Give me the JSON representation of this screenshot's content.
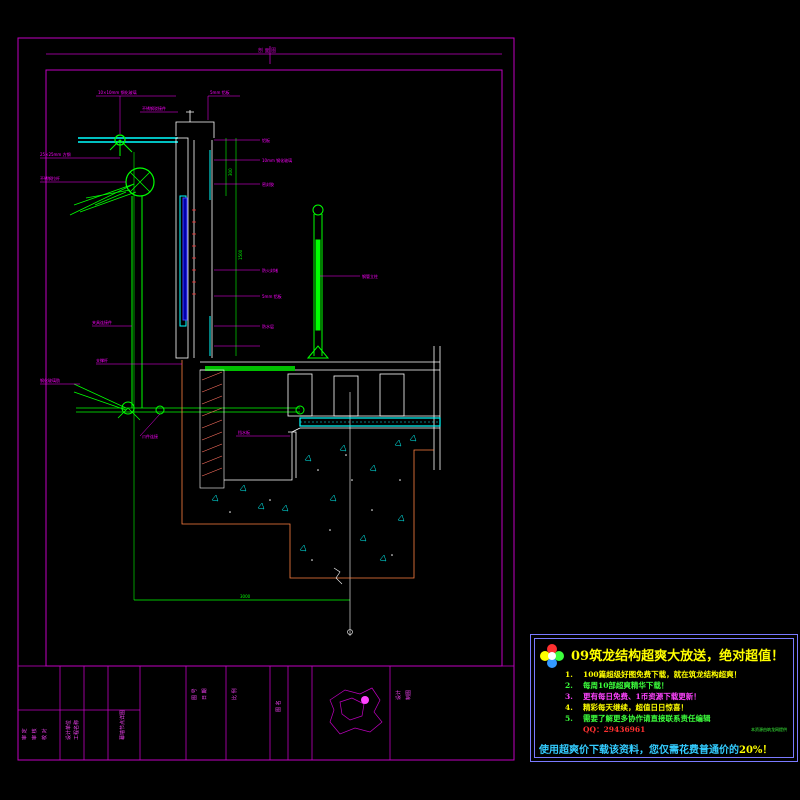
{
  "drawing": {
    "top_label": "剖 面 图",
    "dimension_bottom": "3000",
    "dimension_vertical_1": "300",
    "dimension_vertical_2": "1500",
    "labels_left": [
      "25×25mm 方钢",
      "不锈钢拉杆",
      "夹具连接件",
      "支撑杆",
      "钢化玻璃肋",
      "爪件连接"
    ],
    "labels_top": [
      "10×10mm 钢化玻璃",
      "不锈钢驳接件",
      "5mm 铝板"
    ],
    "labels_right": [
      "铝板",
      "10mm 钢化玻璃",
      "密封胶",
      "防火封堵",
      "5mm 铝板",
      "钢管立柱",
      "防水层",
      "挡水板"
    ],
    "colors": {
      "frame": "#c000c0",
      "steel": "#00e000",
      "glass": "#00ffff",
      "label": "#ff00ff",
      "concrete": "#ffffff",
      "hatch": "#ff7060"
    }
  },
  "title_block": {
    "col1": [
      "审 定",
      "审 核",
      "校 对"
    ],
    "col2": [
      "设计单位",
      "工程名称"
    ],
    "col3": [
      "幕墙节点详图"
    ],
    "col4": [
      "图 号",
      "日 期"
    ],
    "col5": [
      "比 例"
    ],
    "col6": [
      "图 名"
    ],
    "col7": [
      "设计",
      "制图"
    ]
  },
  "ad": {
    "title": "09筑龙结构超爽大放送，绝对超值！",
    "items": [
      {
        "num": "1.",
        "text": "100篇超级好图免费下载，就在筑龙结构超爽！",
        "color": "#ffff00"
      },
      {
        "num": "2.",
        "text": "每周10部超爽精华下载！",
        "color": "#3cff3c"
      },
      {
        "num": "3.",
        "text": "更有每日免费、1币资源下载更新！",
        "color": "#ff44ff"
      },
      {
        "num": "4.",
        "text": "精彩每天继续，超值日日惊喜！",
        "color": "#ffff00"
      },
      {
        "num": "5.",
        "text": "需要了解更多协作请直接联系责任编辑",
        "color": "#3cff3c"
      },
      {
        "num": "",
        "text": "QQ：29436961",
        "color": "#ff3030"
      }
    ],
    "note": "本资源由筑龙网提供",
    "footer_prefix": "使用超爽价下载该资料，您仅需花费普通价的",
    "footer_highlight": "20%！"
  }
}
